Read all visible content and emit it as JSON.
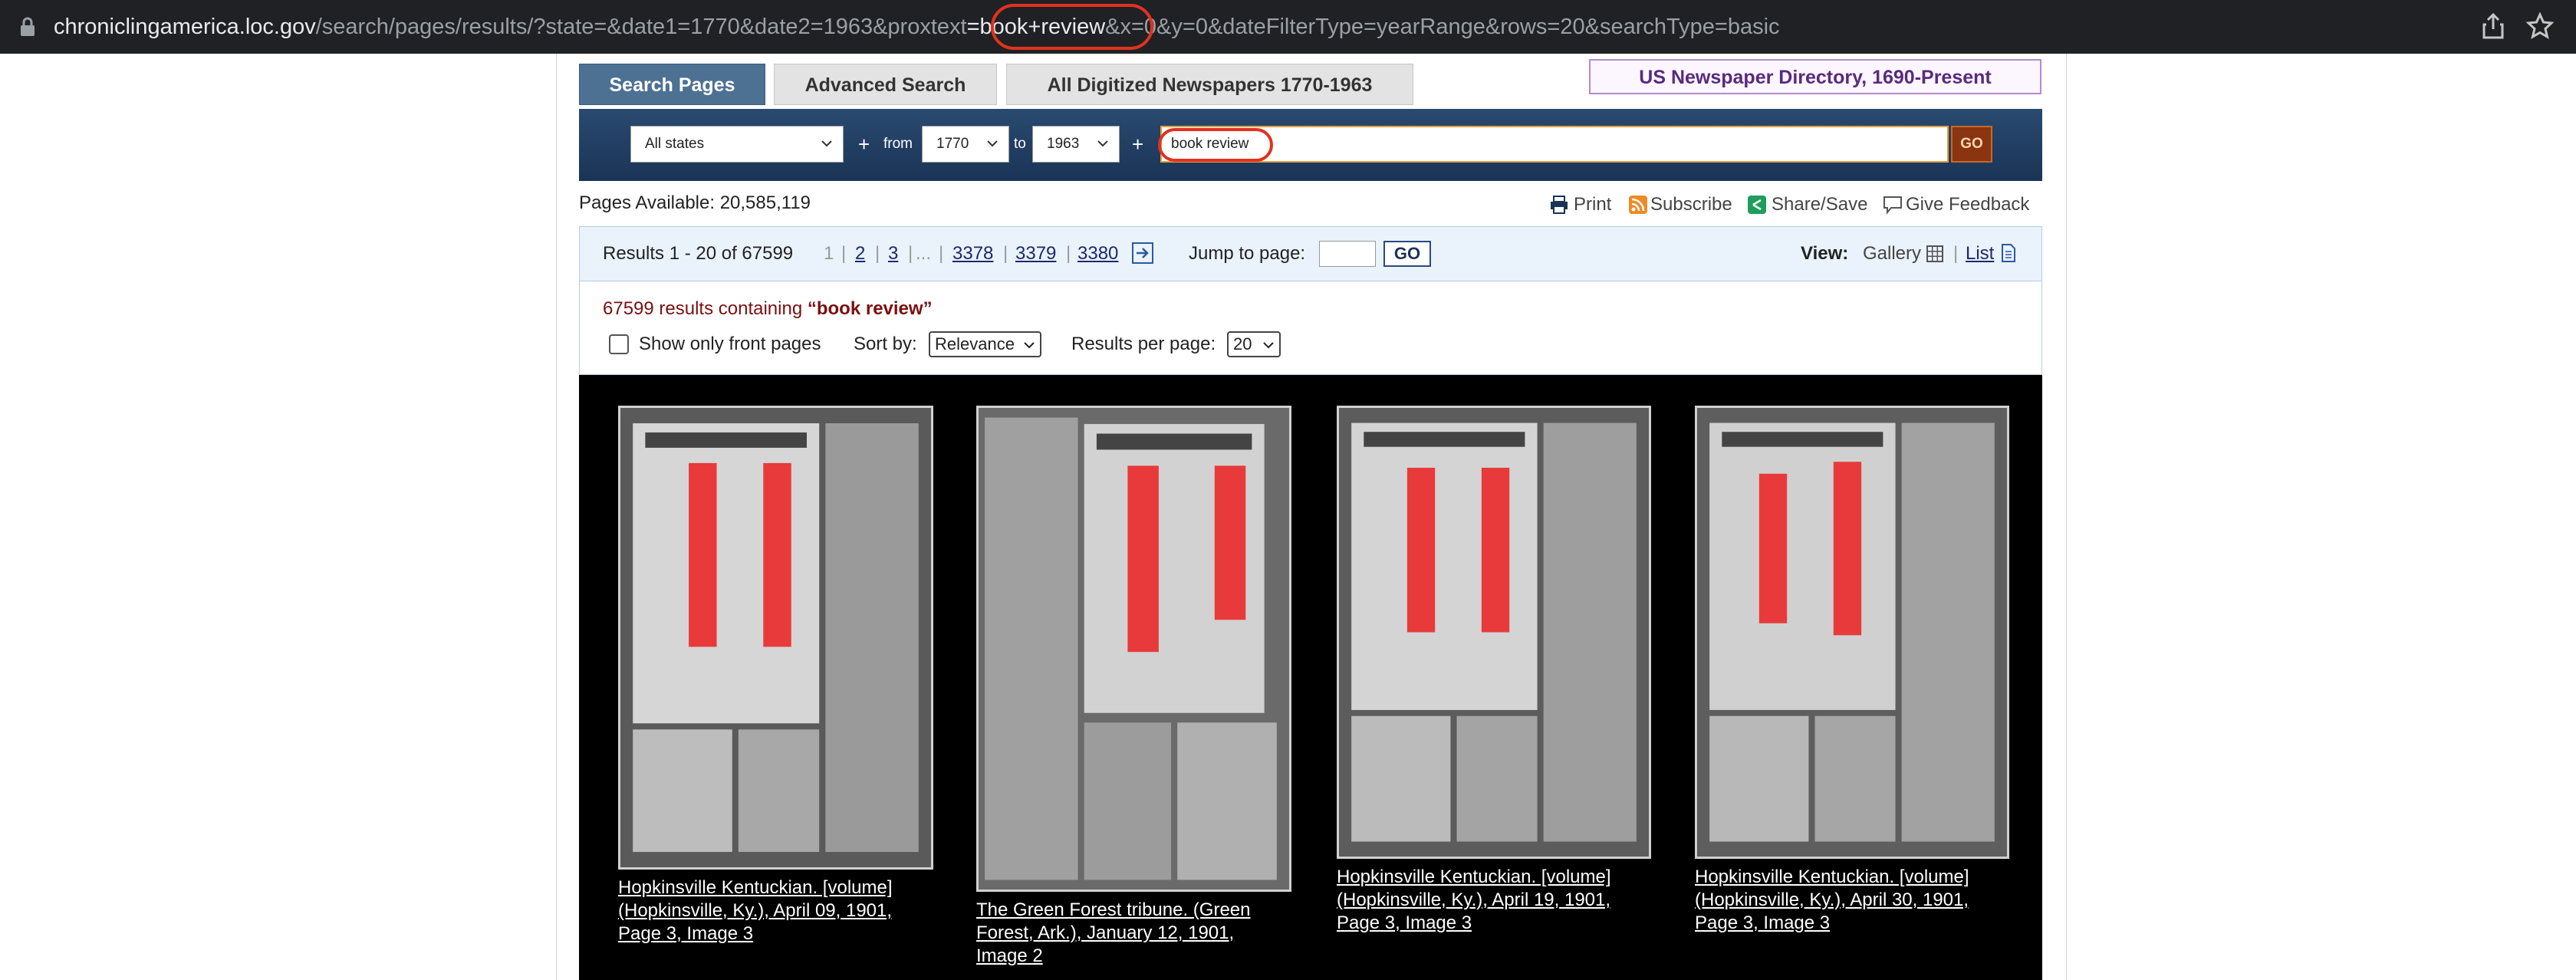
{
  "browser": {
    "url_host": "chroniclingamerica.loc.gov",
    "url_path_before": "/search/pages/results/?state=&date1=1770&date2=1963&proxtext",
    "url_highlight": "=book+review",
    "url_path_after": "&x=0&y=0&dateFilterType=yearRange&rows=20&searchType=basic",
    "lock_icon": "lock-icon",
    "share_icon": "share-icon",
    "star_icon": "star-icon"
  },
  "tabs": {
    "search_pages": "Search Pages",
    "advanced_search": "Advanced Search",
    "all_digitized": "All Digitized Newspapers 1770-1963"
  },
  "directory_link": "US Newspaper Directory, 1690-Present",
  "search": {
    "state": "All states",
    "from_label": "from",
    "from_year": "1770",
    "to_label": "to",
    "to_year": "1963",
    "plus": "+",
    "query": "book review",
    "go": "GO"
  },
  "toolbar": {
    "pages_available": "Pages Available: 20,585,119",
    "print": "Print",
    "subscribe": "Subscribe",
    "share_save": "Share/Save",
    "give_feedback": "Give Feedback"
  },
  "results_bar": {
    "summary": "Results 1 - 20 of 67599",
    "current_page": "1",
    "pages": [
      "2",
      "3"
    ],
    "ellipsis": "...",
    "last_pages": [
      "3378",
      "3379",
      "3380"
    ],
    "jump_label": "Jump to page:",
    "jump_go": "GO",
    "view_label": "View:",
    "gallery": "Gallery",
    "list": "List"
  },
  "info": {
    "count_prefix": "67599 results containing",
    "count_query": "“book review”",
    "front_pages_label": "Show only front pages",
    "sort_label": "Sort by:",
    "sort_value": "Relevance",
    "per_page_label": "Results per page:",
    "per_page_value": "20"
  },
  "results": [
    {
      "caption": [
        "Hopkinsville Kentuckian. [volume]",
        "(Hopkinsville, Ky.), April 09, 1901,",
        "Page 3, Image 3"
      ]
    },
    {
      "caption": [
        "The Green Forest tribune. (Green",
        "Forest, Ark.), January 12, 1901,",
        "Image 2"
      ]
    },
    {
      "caption": [
        "Hopkinsville Kentuckian. [volume]",
        "(Hopkinsville, Ky.), April 19, 1901,",
        "Page 3, Image 3"
      ]
    },
    {
      "caption": [
        "Hopkinsville Kentuckian. [volume]",
        "(Hopkinsville, Ky.), April 30, 1901,",
        "Page 3, Image 3"
      ]
    }
  ],
  "colors": {
    "highlight_ring": "#e1321f",
    "tab_active": "#4d7193",
    "search_bar": "#1a3456",
    "go_button": "#8a3510"
  }
}
